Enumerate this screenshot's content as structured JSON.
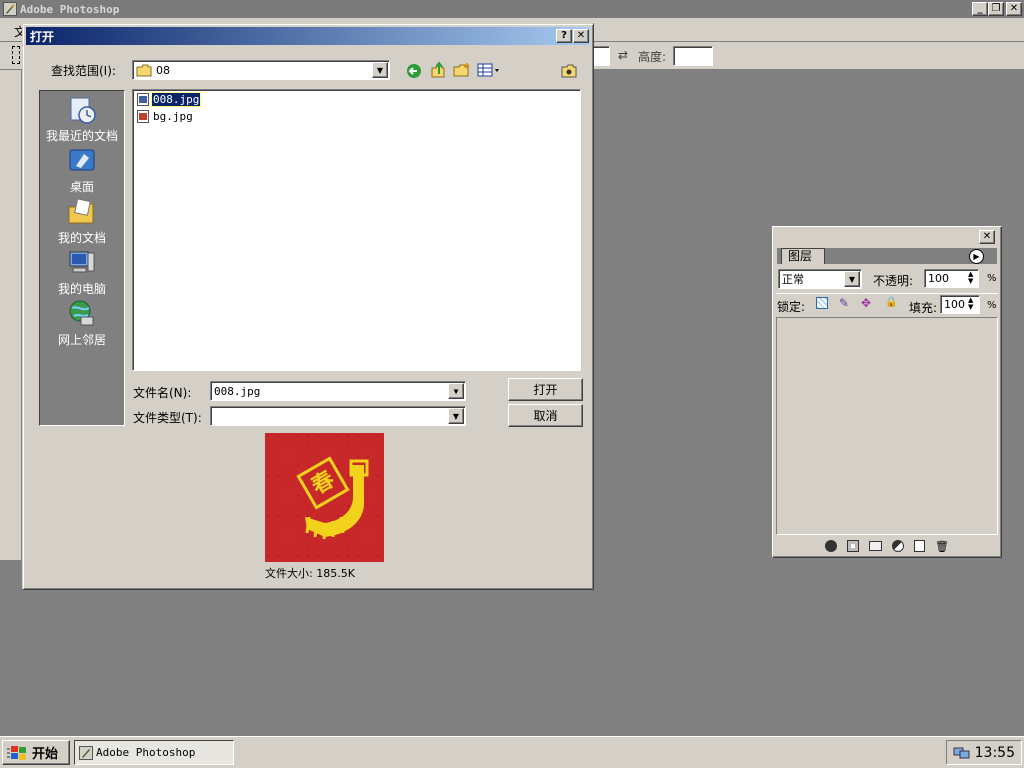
{
  "app": {
    "title": "Adobe Photoshop",
    "menu_first_letter": "文",
    "options_bar": {
      "height_label": "高度:"
    }
  },
  "dialog": {
    "title": "打开",
    "help_label": "?",
    "close_label": "✕",
    "look_in_label": "查找范围(I):",
    "look_in_value": "08",
    "places": [
      {
        "label": "我最近的文档",
        "icon": "recent-documents-icon"
      },
      {
        "label": "桌面",
        "icon": "desktop-icon"
      },
      {
        "label": "我的文档",
        "icon": "my-documents-icon"
      },
      {
        "label": "我的电脑",
        "icon": "my-computer-icon"
      },
      {
        "label": "网上邻居",
        "icon": "network-places-icon"
      }
    ],
    "files": [
      {
        "name": "008.jpg",
        "selected": true
      },
      {
        "name": "bg.jpg",
        "selected": false
      }
    ],
    "filename_label": "文件名(N):",
    "filename_value": "008.jpg",
    "filetype_label": "文件类型(T):",
    "filetype_value": "",
    "open_button": "打开",
    "cancel_button": "取消",
    "preview_glyph": "春",
    "file_size": "文件大小: 185.5K"
  },
  "layers": {
    "tab_label": "图层",
    "blend_mode": "正常",
    "opacity_label": "不透明:",
    "opacity_value": "100",
    "percent": "%",
    "lock_label": "锁定:",
    "fill_label": "填充:",
    "fill_value": "100",
    "close_label": "✕"
  },
  "taskbar": {
    "start_label": "开始",
    "task_label": "Adobe Photoshop",
    "clock": "13:55"
  }
}
